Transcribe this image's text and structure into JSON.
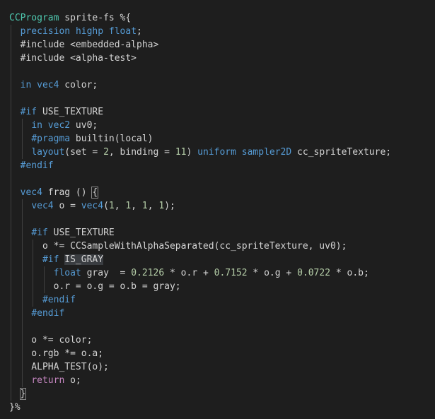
{
  "editor": {
    "lines": [
      [
        {
          "t": "CCProgram",
          "c": "tok-type"
        },
        {
          "t": " sprite-fs %{",
          "c": "tok-text"
        }
      ],
      [
        {
          "t": "  ",
          "c": "tok-text"
        },
        {
          "t": "precision",
          "c": "tok-key"
        },
        {
          "t": " ",
          "c": "tok-text"
        },
        {
          "t": "highp",
          "c": "tok-key"
        },
        {
          "t": " ",
          "c": "tok-text"
        },
        {
          "t": "float",
          "c": "tok-key"
        },
        {
          "t": ";",
          "c": "tok-text"
        }
      ],
      [
        {
          "t": "  #include <embedded-alpha>",
          "c": "tok-text"
        }
      ],
      [
        {
          "t": "  #include <alpha-test>",
          "c": "tok-text"
        }
      ],
      [],
      [
        {
          "t": "  ",
          "c": "tok-text"
        },
        {
          "t": "in",
          "c": "tok-key"
        },
        {
          "t": " ",
          "c": "tok-text"
        },
        {
          "t": "vec4",
          "c": "tok-key"
        },
        {
          "t": " color;",
          "c": "tok-text"
        }
      ],
      [],
      [
        {
          "t": "  ",
          "c": "tok-text"
        },
        {
          "t": "#if",
          "c": "tok-pp"
        },
        {
          "t": " USE_TEXTURE",
          "c": "tok-text"
        }
      ],
      [
        {
          "t": "    ",
          "c": "tok-text"
        },
        {
          "t": "in",
          "c": "tok-key"
        },
        {
          "t": " ",
          "c": "tok-text"
        },
        {
          "t": "vec2",
          "c": "tok-key"
        },
        {
          "t": " uv0;",
          "c": "tok-text"
        }
      ],
      [
        {
          "t": "    ",
          "c": "tok-text"
        },
        {
          "t": "#pragma",
          "c": "tok-pp"
        },
        {
          "t": " builtin(local)",
          "c": "tok-text"
        }
      ],
      [
        {
          "t": "    ",
          "c": "tok-text"
        },
        {
          "t": "layout",
          "c": "tok-key"
        },
        {
          "t": "(set = ",
          "c": "tok-text"
        },
        {
          "t": "2",
          "c": "tok-num"
        },
        {
          "t": ", binding = ",
          "c": "tok-text"
        },
        {
          "t": "11",
          "c": "tok-num"
        },
        {
          "t": ") ",
          "c": "tok-text"
        },
        {
          "t": "uniform",
          "c": "tok-key"
        },
        {
          "t": " ",
          "c": "tok-text"
        },
        {
          "t": "sampler2D",
          "c": "tok-key"
        },
        {
          "t": " cc_spriteTexture;",
          "c": "tok-text"
        }
      ],
      [
        {
          "t": "  ",
          "c": "tok-text"
        },
        {
          "t": "#endif",
          "c": "tok-pp"
        }
      ],
      [],
      [
        {
          "t": "  ",
          "c": "tok-text"
        },
        {
          "t": "vec4",
          "c": "tok-key"
        },
        {
          "t": " frag () ",
          "c": "tok-text"
        },
        {
          "t": "{",
          "c": "tok-text",
          "box": true
        }
      ],
      [
        {
          "t": "    ",
          "c": "tok-text"
        },
        {
          "t": "vec4",
          "c": "tok-key"
        },
        {
          "t": " o = ",
          "c": "tok-text"
        },
        {
          "t": "vec4",
          "c": "tok-key"
        },
        {
          "t": "(",
          "c": "tok-text"
        },
        {
          "t": "1",
          "c": "tok-num"
        },
        {
          "t": ", ",
          "c": "tok-text"
        },
        {
          "t": "1",
          "c": "tok-num"
        },
        {
          "t": ", ",
          "c": "tok-text"
        },
        {
          "t": "1",
          "c": "tok-num"
        },
        {
          "t": ", ",
          "c": "tok-text"
        },
        {
          "t": "1",
          "c": "tok-num"
        },
        {
          "t": ");",
          "c": "tok-text"
        }
      ],
      [],
      [
        {
          "t": "    ",
          "c": "tok-text"
        },
        {
          "t": "#if",
          "c": "tok-pp"
        },
        {
          "t": " USE_TEXTURE",
          "c": "tok-text"
        }
      ],
      [
        {
          "t": "      o *= CCSampleWithAlphaSeparated(cc_spriteTexture, uv0);",
          "c": "tok-text"
        }
      ],
      [
        {
          "t": "      ",
          "c": "tok-text"
        },
        {
          "t": "#if",
          "c": "tok-pp"
        },
        {
          "t": " ",
          "c": "tok-text"
        },
        {
          "t": "IS_GRAY",
          "c": "tok-text",
          "hl": true
        }
      ],
      [
        {
          "t": "        ",
          "c": "tok-text"
        },
        {
          "t": "float",
          "c": "tok-key"
        },
        {
          "t": " gray  = ",
          "c": "tok-text"
        },
        {
          "t": "0.2126",
          "c": "tok-num"
        },
        {
          "t": " * o.r + ",
          "c": "tok-text"
        },
        {
          "t": "0.7152",
          "c": "tok-num"
        },
        {
          "t": " * o.g + ",
          "c": "tok-text"
        },
        {
          "t": "0.0722",
          "c": "tok-num"
        },
        {
          "t": " * o.b;",
          "c": "tok-text"
        }
      ],
      [
        {
          "t": "        o.r = o.g = o.b = gray;",
          "c": "tok-text"
        }
      ],
      [
        {
          "t": "      ",
          "c": "tok-text"
        },
        {
          "t": "#endif",
          "c": "tok-pp"
        }
      ],
      [
        {
          "t": "    ",
          "c": "tok-text"
        },
        {
          "t": "#endif",
          "c": "tok-pp"
        }
      ],
      [],
      [
        {
          "t": "    o *= color;",
          "c": "tok-text"
        }
      ],
      [
        {
          "t": "    o.rgb *= o.a;",
          "c": "tok-text"
        }
      ],
      [
        {
          "t": "    ALPHA_TEST(o);",
          "c": "tok-text"
        }
      ],
      [
        {
          "t": "    ",
          "c": "tok-text"
        },
        {
          "t": "return",
          "c": "tok-ctrl"
        },
        {
          "t": " o;",
          "c": "tok-text"
        }
      ],
      [
        {
          "t": "  ",
          "c": "tok-text"
        },
        {
          "t": "}",
          "c": "tok-text",
          "box": true
        }
      ],
      [
        {
          "t": "}%",
          "c": "tok-text"
        }
      ]
    ],
    "indent_guides": [
      [],
      [
        1
      ],
      [
        1
      ],
      [
        1
      ],
      [
        1
      ],
      [
        1
      ],
      [
        1
      ],
      [
        1
      ],
      [
        1,
        2
      ],
      [
        1,
        2
      ],
      [
        1,
        2
      ],
      [
        1
      ],
      [
        1
      ],
      [
        1
      ],
      [
        1,
        2
      ],
      [
        1,
        2
      ],
      [
        1,
        2
      ],
      [
        1,
        2,
        3
      ],
      [
        1,
        2,
        3
      ],
      [
        1,
        2,
        3,
        4
      ],
      [
        1,
        2,
        3,
        4
      ],
      [
        1,
        2,
        3
      ],
      [
        1,
        2
      ],
      [
        1,
        2
      ],
      [
        1,
        2
      ],
      [
        1,
        2
      ],
      [
        1,
        2
      ],
      [
        1,
        2
      ],
      [
        1
      ],
      []
    ]
  },
  "theme": {
    "background": "#1e1e1e",
    "keyword": "#569cd6",
    "number": "#b5cea8",
    "type": "#4ec9b0",
    "text": "#d4d4d4",
    "control": "#c586c0"
  }
}
